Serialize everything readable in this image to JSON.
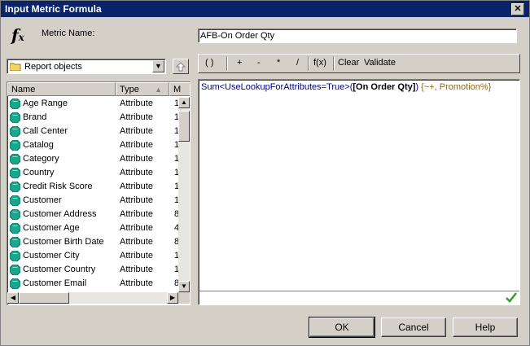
{
  "window": {
    "title": "Input Metric Formula",
    "close_glyph": "✕"
  },
  "metric_name": {
    "label": "Metric Name:",
    "value": "AFB-On Order Qty"
  },
  "object_browser": {
    "dropdown_value": "Report objects",
    "columns": [
      "Name",
      "Type",
      "M"
    ],
    "rows": [
      {
        "name": "Age Range",
        "type": "Attribute",
        "m": "1"
      },
      {
        "name": "Brand",
        "type": "Attribute",
        "m": "1"
      },
      {
        "name": "Call Center",
        "type": "Attribute",
        "m": "1"
      },
      {
        "name": "Catalog",
        "type": "Attribute",
        "m": "1"
      },
      {
        "name": "Category",
        "type": "Attribute",
        "m": "1"
      },
      {
        "name": "Country",
        "type": "Attribute",
        "m": "1"
      },
      {
        "name": "Credit Risk Score",
        "type": "Attribute",
        "m": "1"
      },
      {
        "name": "Customer",
        "type": "Attribute",
        "m": "1"
      },
      {
        "name": "Customer Address",
        "type": "Attribute",
        "m": "8"
      },
      {
        "name": "Customer Age",
        "type": "Attribute",
        "m": "4"
      },
      {
        "name": "Customer Birth Date",
        "type": "Attribute",
        "m": "8"
      },
      {
        "name": "Customer City",
        "type": "Attribute",
        "m": "1"
      },
      {
        "name": "Customer Country",
        "type": "Attribute",
        "m": "1"
      },
      {
        "name": "Customer Email",
        "type": "Attribute",
        "m": "8"
      }
    ]
  },
  "toolbar": {
    "parens": "( )",
    "plus": "+",
    "minus": "-",
    "multiply": "*",
    "divide": "/",
    "function": "f(x)",
    "clear": "Clear",
    "validate": "Validate"
  },
  "formula": {
    "prefix": "Sum<UseLookupForAttributes=True>(",
    "metric": "[On Order Qty]",
    "close": ")",
    "level": " {~+, Promotion%}"
  },
  "buttons": {
    "ok": "OK",
    "cancel": "Cancel",
    "help": "Help"
  },
  "colors": {
    "title_bar": "#0a246a",
    "dialog_bg": "#d4d0c8",
    "attribute_icon": "#19a88c",
    "validate_check": "#2e9e2e"
  }
}
